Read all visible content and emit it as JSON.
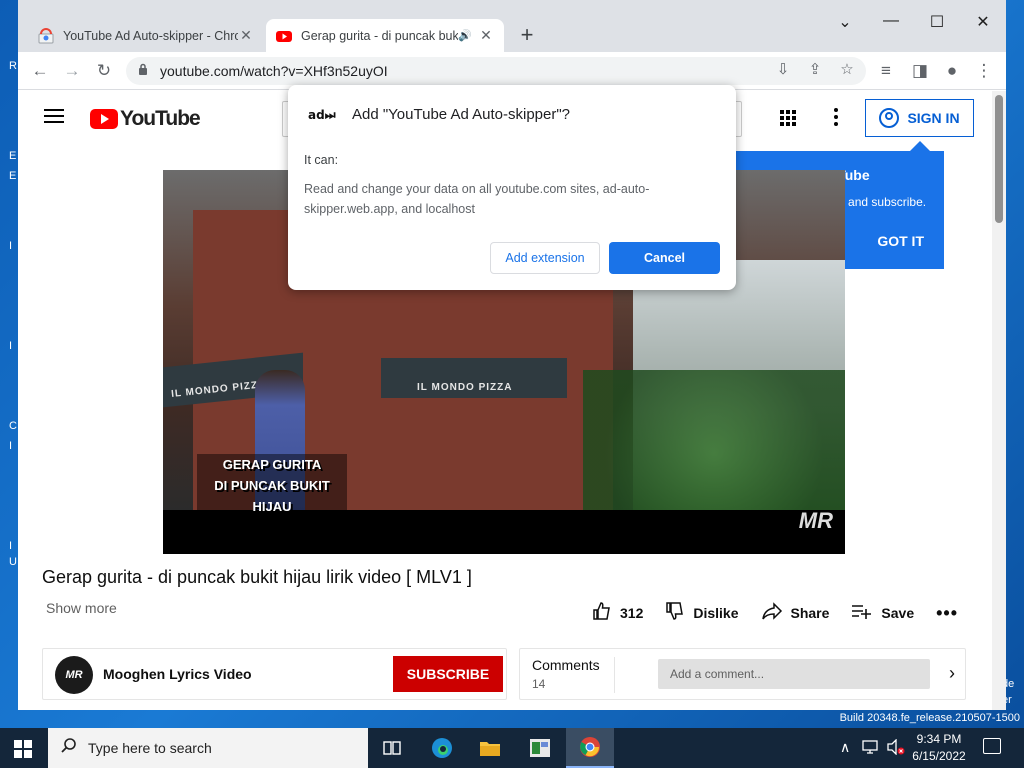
{
  "desktop": {
    "edge_letters": [
      "R",
      "E",
      "E",
      "I",
      "I",
      "I",
      "C",
      "I",
      "U"
    ],
    "right_text": [
      "de",
      "er"
    ],
    "build": "Build 20348.fe_release.210507-1500"
  },
  "browser": {
    "tabs": [
      {
        "title": "YouTube Ad Auto-skipper - Chro",
        "close": "✕"
      },
      {
        "title": "Gerap gurita - di puncak buk",
        "audio": "🔊",
        "close": "✕"
      }
    ],
    "new_tab": "+",
    "window_controls": {
      "dropdown": "⌄",
      "minimize": "—",
      "maximize": "☐",
      "close": "✕"
    },
    "nav": {
      "back": "←",
      "forward": "→",
      "reload": "↻"
    },
    "url": "youtube.com/watch?v=XHf3n52uyOI",
    "omni_icons": {
      "install": "⇩",
      "share": "⇪",
      "bookmark": "☆"
    },
    "toolbar_icons": {
      "media": "≡",
      "side_panel": "◨",
      "profile": "●",
      "menu": "⋮"
    }
  },
  "youtube": {
    "logo_text": "YouTube",
    "sign_in": "SIGN IN",
    "tooltip": {
      "title": "gned out of YouTube",
      "body": "ike videos, comment, and subscribe.",
      "button": "GOT IT"
    },
    "video": {
      "caption_line1": "GERAP GURITA",
      "caption_line2": "DI PUNCAK BUKIT HIJAU",
      "awning1": "IL MONDO PIZZA",
      "awning2": "IL MONDO PIZZA",
      "watermark": "MR"
    },
    "title": "Gerap gurita - di puncak bukit hijau lirik video [ MLV1 ]",
    "show_more": "Show more",
    "actions": {
      "likes": "312",
      "dislike": "Dislike",
      "share": "Share",
      "save": "Save",
      "more": "•••"
    },
    "channel": {
      "avatar_text": "MR",
      "name": "Mooghen Lyrics Video",
      "subscribe": "SUBSCRIBE"
    },
    "comments": {
      "label": "Comments",
      "count": "14",
      "placeholder": "Add a comment...",
      "arrow": "›"
    }
  },
  "dialog": {
    "icon_text": "ad⏭",
    "title": "Add \"YouTube Ad Auto-skipper\"?",
    "it_can": "It can:",
    "permission": "Read and change your data on all youtube.com sites, ad-auto-skipper.web.app, and localhost",
    "add_button": "Add extension",
    "cancel_button": "Cancel"
  },
  "taskbar": {
    "search_placeholder": "Type here to search",
    "time": "9:34 PM",
    "date": "6/15/2022"
  },
  "colors": {
    "youtube_red": "#ff0000",
    "subscribe_red": "#cc0000",
    "chrome_blue": "#1a73e8",
    "sign_in_blue": "#065fd4",
    "taskbar": "#14263a"
  }
}
